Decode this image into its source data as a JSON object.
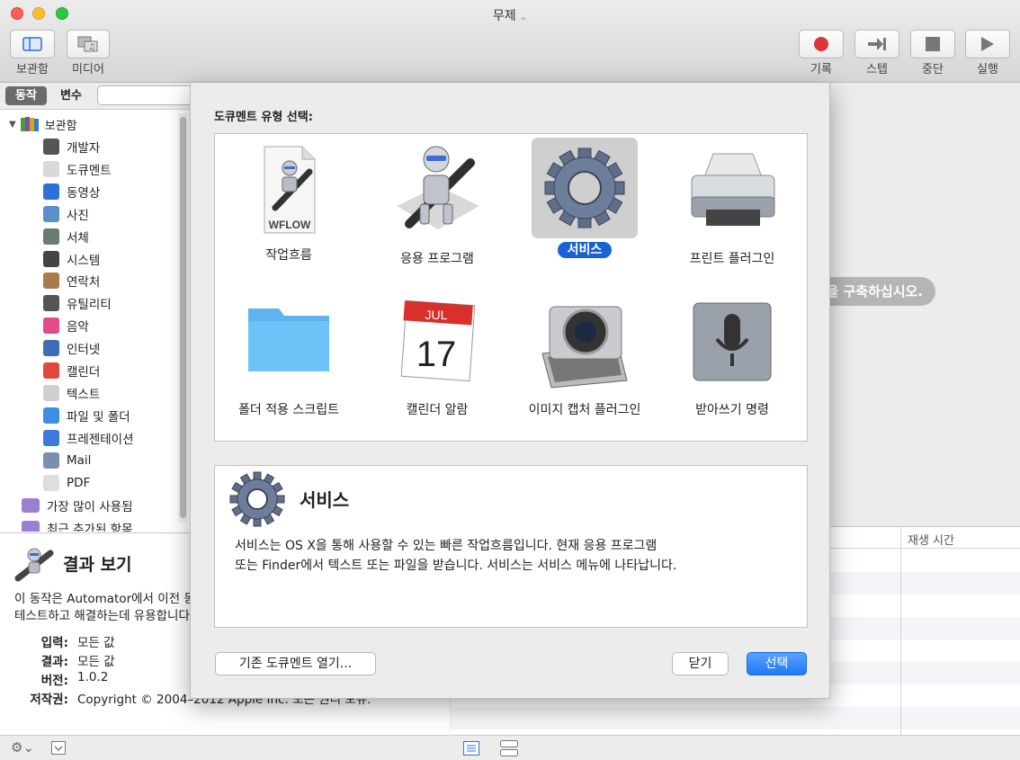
{
  "window": {
    "title": "무제"
  },
  "toolbar": {
    "library_label": "보관함",
    "media_label": "미디어",
    "record_label": "기록",
    "step_label": "스텝",
    "stop_label": "중단",
    "run_label": "실행"
  },
  "library": {
    "tab_actions": "동작",
    "tab_variables": "변수",
    "root_label": "보관함",
    "items": [
      {
        "label": "개발자",
        "icon": "developer-icon",
        "color": "#555555"
      },
      {
        "label": "도큐멘트",
        "icon": "document-icon",
        "color": "#d8d8d8"
      },
      {
        "label": "동영상",
        "icon": "movie-icon",
        "color": "#2f6fd8"
      },
      {
        "label": "사진",
        "icon": "photo-icon",
        "color": "#5a8fc8"
      },
      {
        "label": "서체",
        "icon": "font-icon",
        "color": "#6b7b70"
      },
      {
        "label": "시스템",
        "icon": "system-icon",
        "color": "#444444"
      },
      {
        "label": "연락처",
        "icon": "contacts-icon",
        "color": "#a77b4a"
      },
      {
        "label": "유틸리티",
        "icon": "utilities-icon",
        "color": "#555555"
      },
      {
        "label": "음악",
        "icon": "music-icon",
        "color": "#e34b8b"
      },
      {
        "label": "인터넷",
        "icon": "internet-icon",
        "color": "#3d6db5"
      },
      {
        "label": "캘린더",
        "icon": "calendar-icon",
        "color": "#e04a3c"
      },
      {
        "label": "텍스트",
        "icon": "text-icon",
        "color": "#cfcfcf"
      },
      {
        "label": "파일 및 폴더",
        "icon": "finder-icon",
        "color": "#3a8ee6"
      },
      {
        "label": "프레젠테이션",
        "icon": "presentation-icon",
        "color": "#3b7be0"
      },
      {
        "label": "Mail",
        "icon": "mail-icon",
        "color": "#7a8fb0"
      },
      {
        "label": "PDF",
        "icon": "pdf-icon",
        "color": "#dedede"
      }
    ],
    "smart_groups": [
      {
        "label": "가장 많이 사용됨"
      },
      {
        "label": "최근 추가된 항목"
      }
    ]
  },
  "description": {
    "title": "결과 보기",
    "body": "이 동작은 Automator에서 이전 동\n테스트하고 해결하는데 유용합니다",
    "input_key": "입력:",
    "input_value": "모든 값",
    "result_key": "결과:",
    "result_value": "모든 값",
    "version_key": "버전:",
    "version_value": "1.0.2",
    "copyright_key": "저작권:",
    "copyright_value": "Copyright © 2004–2012 Apple Inc. 모든 권리 보유."
  },
  "workflow": {
    "hint": "을 구축하십시오.",
    "log_col_time": "재생 시간"
  },
  "dialog": {
    "title": "도큐멘트 유형 선택:",
    "types": [
      {
        "label": "작업흐름",
        "icon": "workflow-document-icon",
        "badge": "WFLOW",
        "selected": false
      },
      {
        "label": "응용 프로그램",
        "icon": "automator-robot-icon",
        "selected": false
      },
      {
        "label": "서비스",
        "icon": "gear-icon",
        "selected": true
      },
      {
        "label": "프린트 플러그인",
        "icon": "printer-icon",
        "selected": false
      },
      {
        "label": "폴더 적용 스크립트",
        "icon": "folder-icon",
        "selected": false
      },
      {
        "label": "캘린더 알람",
        "icon": "calendar-icon",
        "month": "JUL",
        "day": "17",
        "selected": false
      },
      {
        "label": "이미지 캡처 플러그인",
        "icon": "camera-icon",
        "selected": false
      },
      {
        "label": "받아쓰기 명령",
        "icon": "microphone-icon",
        "selected": false
      }
    ],
    "info_title": "서비스",
    "info_body": "서비스는 OS X을 통해 사용할 수 있는 빠른 작업흐름입니다. 현재 응용 프로그램\n또는 Finder에서 텍스트 또는 파일을 받습니다. 서비스는 서비스 메뉴에 나타납니다.",
    "open_existing_label": "기존 도큐멘트 열기...",
    "close_label": "닫기",
    "choose_label": "선택",
    "accent_color": "#1862d6"
  }
}
